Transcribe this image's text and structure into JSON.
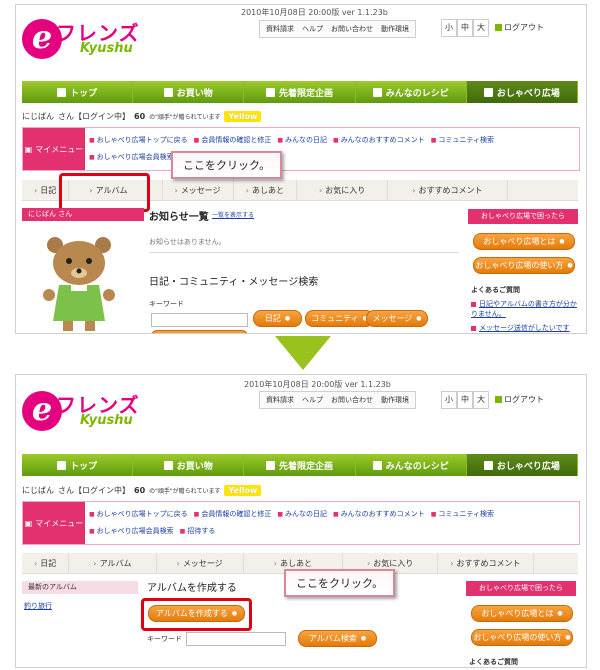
{
  "header": {
    "version": "2010年10月08日 20:00版 ver 1.1.23b",
    "util_links": [
      "資料請求",
      "ヘルプ",
      "お問い合わせ",
      "動作環境"
    ],
    "size_buttons": [
      "小",
      "中",
      "大"
    ],
    "logout": "ログアウト",
    "logo_e": "e",
    "logo_main": "フレンズ",
    "logo_sub": "Kyushu"
  },
  "nav": {
    "items": [
      "トップ",
      "お買い物",
      "先着限定企画",
      "みんなのレシピ",
      "おしゃべり広場"
    ]
  },
  "user": {
    "name": "にじばん",
    "suffix": "さん【ログイン中】",
    "count": "60",
    "count_text": "の\"頑手\"が贈られています",
    "badge": "Yellow"
  },
  "mymenu": {
    "label": "マイメニュー",
    "links": [
      "おしゃべり広場トップに戻る",
      "会員情報の確認と修正",
      "みんなの日記",
      "みんなのおすすめコメント",
      "コミュニティ検索",
      "おしゃべり広場会員検索",
      "招待する"
    ]
  },
  "top": {
    "tabs": [
      "日記",
      "アルバム",
      "メッセージ",
      "あしあと",
      "お気に入り",
      "おすすめコメント"
    ],
    "sidebar_title": "にじばん さん",
    "notice_title": "お知らせ一覧",
    "notice_link": "一覧を表示する",
    "notice_empty": "お知らせはありません。",
    "search_title": "日記・コミュニティ・メッセージ検索",
    "keyword_label": "キーワード",
    "search_buttons": [
      "日記",
      "コミュニティ",
      "メッセージ"
    ],
    "right_title": "おしゃべり広場で困ったら",
    "right_buttons": [
      "おしゃべり広場とは",
      "おしゃべり広場の使い方"
    ],
    "faq_title": "よくあるご質問",
    "faq_items": [
      "日記やアルバムの書き方が分かりません。",
      "メッセージ送信がしたいです"
    ],
    "callout": "ここをクリック。"
  },
  "bottom": {
    "tabs": [
      "日記",
      "アルバム",
      "メッセージ",
      "あしあと",
      "お気に入り",
      "おすすめコメント"
    ],
    "sidebar_title": "最新のアルバム",
    "sidebar_item": "釣り旅行",
    "album_title": "アルバムを作成する",
    "create_button": "アルバムを作成する",
    "keyword_label": "キーワード",
    "search_button": "アルバム検索",
    "right_title": "おしゃべり広場で困ったら",
    "right_buttons": [
      "おしゃべり広場とは",
      "おしゃべり広場の使い方"
    ],
    "faq_title": "よくあるご質問",
    "callout": "ここをクリック。"
  },
  "colors": {
    "nav_green": "#7ab800",
    "brand_pink": "#e2316e",
    "button_orange": "#f08c1e",
    "highlight_red": "#e00011",
    "arrow_green": "#9ac21e"
  }
}
